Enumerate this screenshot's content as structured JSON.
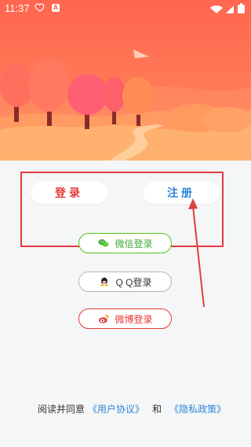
{
  "status_bar": {
    "time": "11:37",
    "icons": [
      "heart-icon",
      "a-icon",
      "wifi-icon",
      "signal-icon",
      "battery-icon"
    ]
  },
  "auth": {
    "login_label": "登录",
    "register_label": "注册"
  },
  "social": {
    "wechat_label": "微信登录",
    "qq_label": "Q Q登录",
    "weibo_label": "微博登录"
  },
  "agreement": {
    "prefix": "阅读并同意",
    "user_agreement": "《用户协议》",
    "and": "和",
    "privacy_policy": "《隐私政策》"
  },
  "colors": {
    "brand_red": "#e53935",
    "brand_blue": "#2f86d6",
    "wechat_green": "#52c41a",
    "hero_top": "#ff6b57",
    "hero_bottom": "#ffab6e",
    "panel_bg": "#f5f6f8"
  }
}
